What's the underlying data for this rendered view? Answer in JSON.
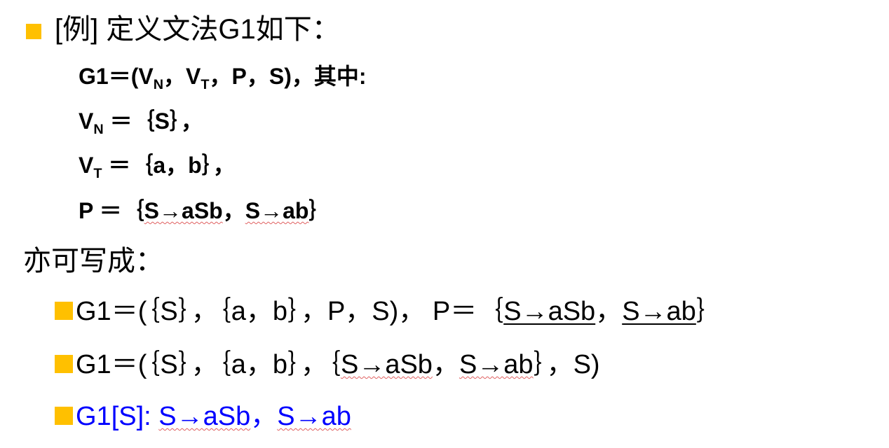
{
  "title": "[例]  定义文法G1如下：",
  "definition": {
    "g1_prefix": "G1＝(V",
    "g1_sub_n": "N",
    "g1_mid": "，V",
    "g1_sub_t": "T",
    "g1_suffix": "，P，S)，其中:",
    "vn_v": "V",
    "vn_sub": "N",
    "vn_rest": " ＝｛S｝，",
    "vt_v": "V",
    "vt_sub": "T",
    "vt_rest": " ＝｛a，b｝，",
    "p_prefix": "P ＝｛",
    "p_rule1": "S→aSb",
    "p_sep": "，",
    "p_rule2": "S→ab",
    "p_suffix": "｝"
  },
  "alternative_heading": "亦可写成：",
  "alternatives": [
    {
      "part1": "G1＝(｛S｝，｛a，b｝，P，S)， P＝｛",
      "rule1": "S→aSb",
      "sep": "，",
      "rule2": "S→ab",
      "part2": "｝"
    },
    {
      "part1": "G1＝(｛S｝，｛a，b｝，｛",
      "rule1": "S→aSb",
      "sep": "，",
      "rule2": "S→ab",
      "part2": "｝，S)"
    },
    {
      "part1": "G1[S]: ",
      "rule1": "S→aSb",
      "sep": "，",
      "rule2": "S→ab"
    }
  ],
  "colors": {
    "bullet": "#ffc000",
    "link_text": "#0000ff",
    "spellcheck_underline": "#e06060"
  },
  "icons": {
    "bullet": "square-bullet-icon"
  }
}
